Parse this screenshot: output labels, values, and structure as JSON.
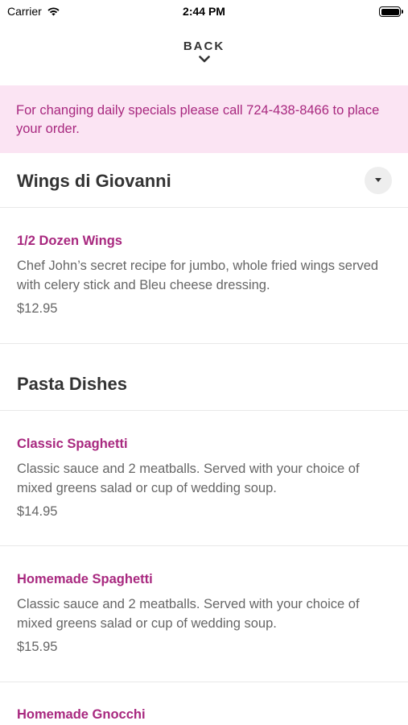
{
  "status_bar": {
    "carrier": "Carrier",
    "time": "2:44 PM"
  },
  "nav": {
    "back_label": "BACK"
  },
  "notice": {
    "text": "For changing daily specials please call 724-438-8466 to place your order."
  },
  "sections": [
    {
      "title": "Wings di Giovanni",
      "items": [
        {
          "name": "1/2 Dozen Wings",
          "description": "Chef John’s secret recipe for jumbo, whole fried wings served with celery stick and Bleu cheese dressing.",
          "price": "$12.95"
        }
      ]
    },
    {
      "title": "Pasta Dishes",
      "items": [
        {
          "name": "Classic Spaghetti",
          "description": "Classic sauce and 2 meatballs. Served with your choice of mixed greens salad or cup of wedding soup.",
          "price": "$14.95"
        },
        {
          "name": "Homemade Spaghetti",
          "description": "Classic sauce and 2 meatballs. Served with your choice of mixed greens salad or cup of wedding soup.",
          "price": "$15.95"
        },
        {
          "name": "Homemade Gnocchi"
        }
      ]
    }
  ],
  "colors": {
    "accent": "#a8287f",
    "notice_bg": "#fbe4f3"
  },
  "icons": {
    "wifi": "wifi-icon",
    "battery": "battery-icon",
    "back": "chevron-down-icon",
    "dropdown": "caret-down-icon"
  }
}
